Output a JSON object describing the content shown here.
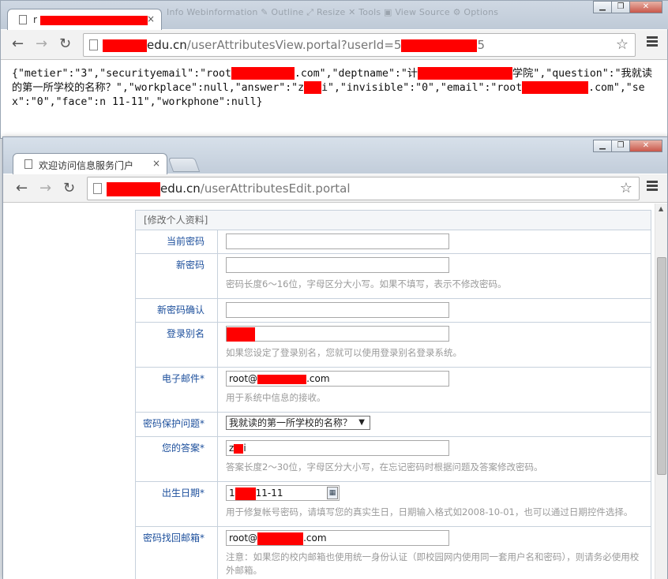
{
  "back_window": {
    "toolbar_ghost": "Info   Webinformation   ✎ Outline   ⤢ Resize   ✕ Tools   ▣ View Source   ⚙ Options",
    "tab_title_prefix": "r",
    "url_domain": "edu.cn",
    "url_path": "/userAttributesView.portal?userId=5",
    "url_suffix": "5",
    "json_text_1": "{\"metier\":\"3\",\"securityemail\":\"root",
    "json_text_2": ".com\",\"deptname\":\"计",
    "json_text_3": "学院\",\"question\":\"我就读的第一所学校的名称？\",\"workplace\":null,\"answer\":\"z",
    "json_text_4": "i\",\"invisible\":\"0\",\"email\":\"root",
    "json_text_5": ".com\",\"sex\":\"0\",\"face\":n",
    "json_text_6": "11-11\",\"workphone\":null}"
  },
  "front_window": {
    "tab_title": "欢迎访问信息服务门户",
    "tab_close": "×",
    "url_domain": "edu.cn",
    "url_path": "/userAttributesEdit.portal",
    "form_title": "[修改个人资料]",
    "fields": {
      "current_password": {
        "label": "当前密码"
      },
      "new_password": {
        "label": "新密码",
        "hint": "密码长度6～16位，字母区分大小写。如果不填写，表示不修改密码。"
      },
      "confirm_password": {
        "label": "新密码确认"
      },
      "login_alias": {
        "label": "登录别名",
        "hint": "如果您设定了登录别名，您就可以使用登录别名登录系统。"
      },
      "email": {
        "label": "电子邮件*",
        "value_prefix": "root@",
        "value_suffix": ".com",
        "hint": "用于系统中信息的接收。"
      },
      "security_question": {
        "label": "密码保护问题*",
        "value": "我就读的第一所学校的名称？",
        "arrow": "▼"
      },
      "answer": {
        "label": "您的答案*",
        "value_prefix": "z",
        "value_suffix": "i",
        "hint": "答案长度2～30位，字母区分大小写，在忘记密码时根据问题及答案修改密码。"
      },
      "birthday": {
        "label": "出生日期*",
        "value_prefix": "1",
        "value_suffix": "11-11",
        "hint": "用于修复帐号密码，请填写您的真实生日，日期输入格式如2008-10-01，也可以通过日期控件选择。"
      },
      "recovery_email": {
        "label": "密码找回邮箱*",
        "value_prefix": "root@",
        "value_suffix": ".com",
        "hint": "注意：如果您的校内邮箱也使用统一身份认证（即校园网内使用同一套用户名和密码），则请务必使用校外邮箱。"
      }
    }
  },
  "icons": [
    "back-arrow-icon",
    "forward-arrow-icon",
    "reload-icon",
    "page-icon",
    "star-icon",
    "menu-icon",
    "calendar-icon"
  ],
  "colors": {
    "redaction": "#ff0000",
    "label_blue": "#1c4f9c",
    "hint_gray": "#9a9a9a"
  }
}
